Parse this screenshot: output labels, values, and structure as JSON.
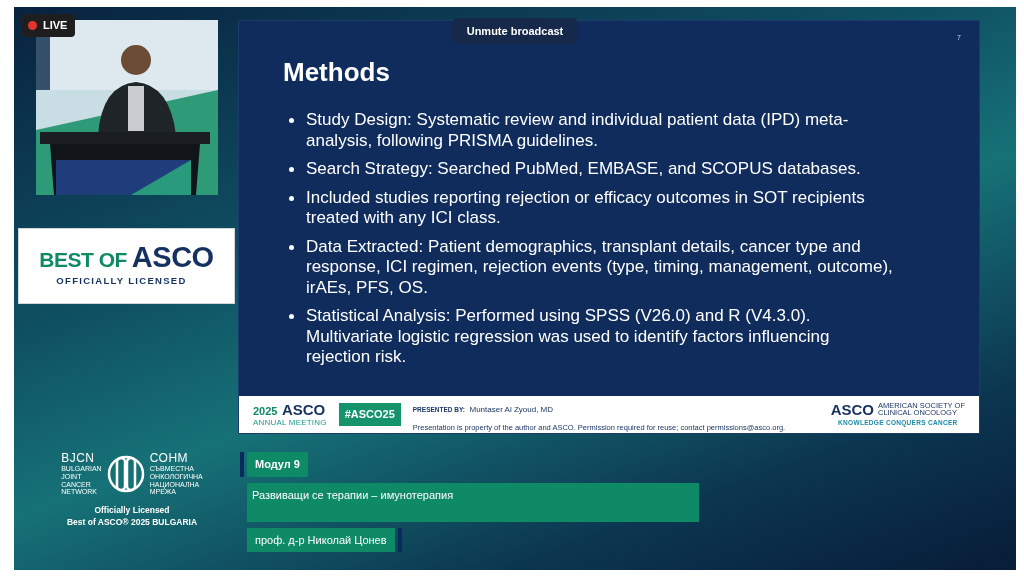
{
  "live_badge": {
    "label": "LIVE"
  },
  "unmute_button": {
    "label": "Unmute broadcast"
  },
  "sponsor_logo": {
    "prefix": "BEST OF",
    "brand": "ASCO",
    "tagline": "OFFICIALLY LICENSED"
  },
  "organizer_logo": {
    "left_abbr": "BJCN",
    "left_lines": [
      "BULGARIAN",
      "JOINT",
      "CANCER",
      "NETWORK"
    ],
    "right_abbr": "СОНМ",
    "right_lines": [
      "СЪВМЕСТНА",
      "ОНКОЛОГИЧНА",
      "НАЦИОНАЛНА",
      "МРЕЖА"
    ],
    "caption": [
      "Officially Licensed",
      "Best of ASCO® 2025 BULGARIA"
    ]
  },
  "slide": {
    "title": "Methods",
    "page_number": "7",
    "bullets": [
      "Study Design: Systematic review and individual patient data (IPD) meta-analysis, following PRISMA guidelines.",
      "Search Strategy: Searched PubMed, EMBASE, and SCOPUS databases.",
      "Included studies reporting rejection or efficacy outcomes in SOT recipients treated with any ICI class.",
      "Data Extracted: Patient demographics, transplant details, cancer type and response, ICI regimen, rejection events (type, timing, management, outcome), irAEs, PFS, OS.",
      "Statistical Analysis: Performed using SPSS (V26.0) and R (V4.3.0). Multivariate logistic regression was used to identify factors influencing rejection risk."
    ],
    "footer": {
      "meeting_year": "2025",
      "meeting_brand": "ASCO",
      "meeting_subtitle": "ANNUAL MEETING",
      "hashtag": "#ASCO25",
      "presented_by_label": "PRESENTED BY:",
      "presenter": "Muntaser Al Zyoud, MD",
      "notice": "Presentation is property of the author and ASCO. Permission required for reuse; contact permissions@asco.org.",
      "society_brand": "ASCO",
      "society_name": [
        "AMERICAN SOCIETY OF",
        "CLINICAL ONCOLOGY"
      ],
      "society_tagline": "KNOWLEDGE CONQUERS CANCER"
    }
  },
  "lower_third": {
    "module": "Модул 9",
    "topic": "Развиващи се терапии – имунотерапия",
    "speaker": "проф. д-р Николай Цонев"
  }
}
